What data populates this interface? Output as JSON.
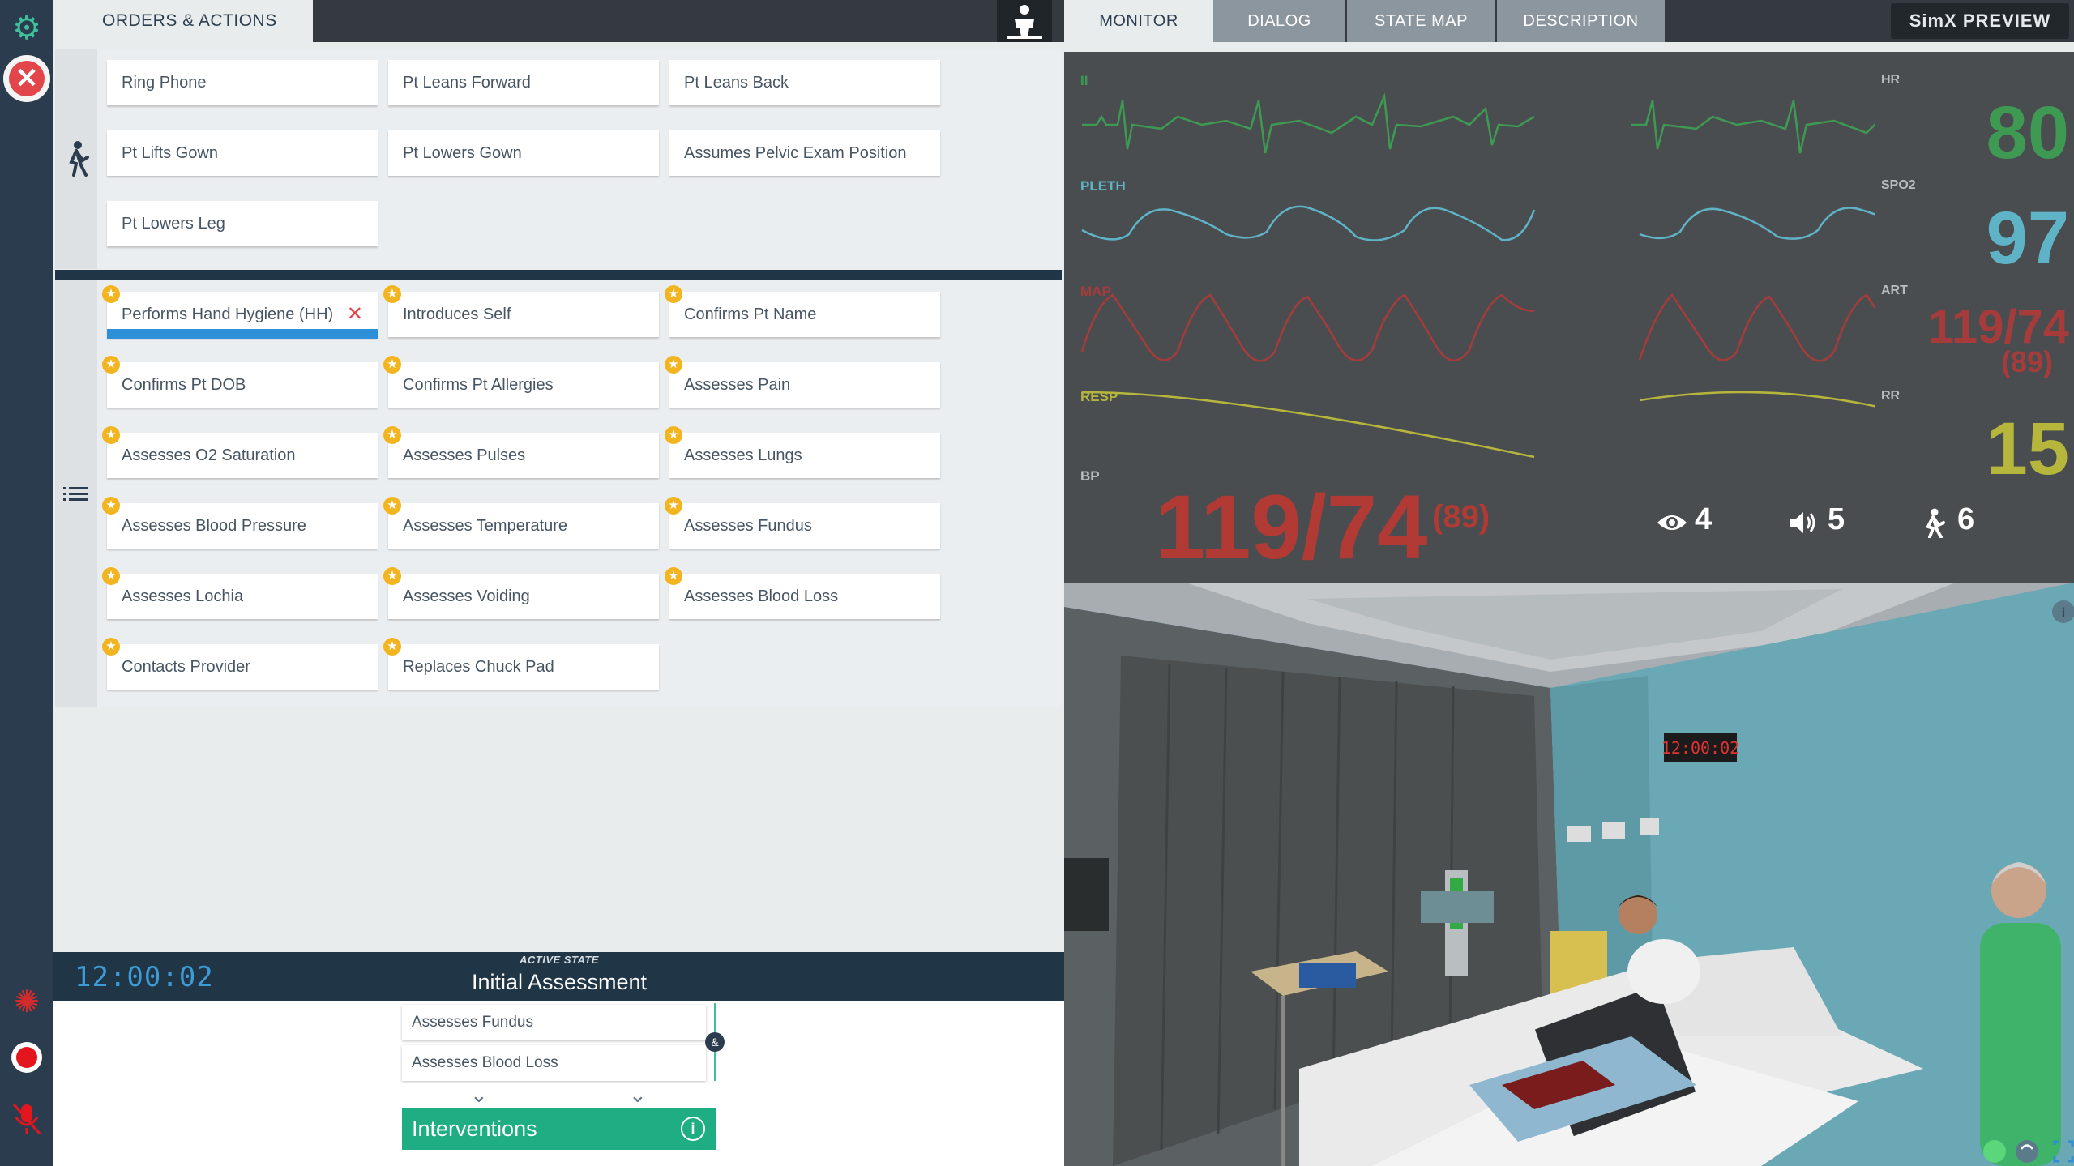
{
  "left_tab": {
    "label": "ORDERS & ACTIONS"
  },
  "patient_actions": [
    "Ring Phone",
    "Pt Leans Forward",
    "Pt Leans Back",
    "Pt Lifts Gown",
    "Pt Lowers Gown",
    "Assumes Pelvic Exam Position",
    "Pt Lowers Leg"
  ],
  "assessment_actions": [
    "Performs Hand Hygiene (HH)",
    "Introduces Self",
    "Confirms Pt Name",
    "Confirms Pt DOB",
    "Confirms Pt Allergies",
    "Assesses Pain",
    "Assesses O2 Saturation",
    "Assesses Pulses",
    "Assesses Lungs",
    "Assesses Blood Pressure",
    "Assesses Temperature",
    "Assesses Fundus",
    "Assesses Lochia",
    "Assesses Voiding",
    "Assesses Blood Loss",
    "Contacts Provider",
    "Replaces Chuck Pad"
  ],
  "active_state": {
    "clock": "12:00:02",
    "label": "ACTIVE STATE",
    "name": "Initial Assessment",
    "pending": [
      "Assesses Fundus",
      "Assesses Blood Loss"
    ],
    "and_symbol": "&",
    "next_state": "Interventions"
  },
  "right_tabs": [
    "MONITOR",
    "DIALOG",
    "STATE MAP",
    "DESCRIPTION"
  ],
  "preview_label": "SimX PREVIEW",
  "monitor": {
    "waves": [
      {
        "label": "II",
        "color": "#3e9a52"
      },
      {
        "label": "PLETH",
        "color": "#5fb3c6"
      },
      {
        "label": "MAP",
        "color": "#a53b3b"
      },
      {
        "label": "RESP",
        "color": "#b7b63c"
      },
      {
        "label": "BP",
        "color": "#b9bdc1"
      }
    ],
    "vitals": {
      "hr_label": "HR",
      "hr": "80",
      "hr_color": "#3e9a52",
      "spo2_label": "SPO2",
      "spo2": "97",
      "spo2_color": "#5fb3c6",
      "art_label": "ART",
      "art": "119/74",
      "art_mean": "(89)",
      "art_color": "#a53b3b",
      "rr_label": "RR",
      "rr": "15",
      "rr_color": "#b7b63c"
    },
    "bp": {
      "value": "119/74",
      "mean": "(89)",
      "color": "#b23a35"
    },
    "counters": {
      "eye": "4",
      "speaker": "5",
      "walk": "6"
    }
  },
  "scene": {
    "wall_clock": "12:00:02",
    "info_icon": "i"
  }
}
